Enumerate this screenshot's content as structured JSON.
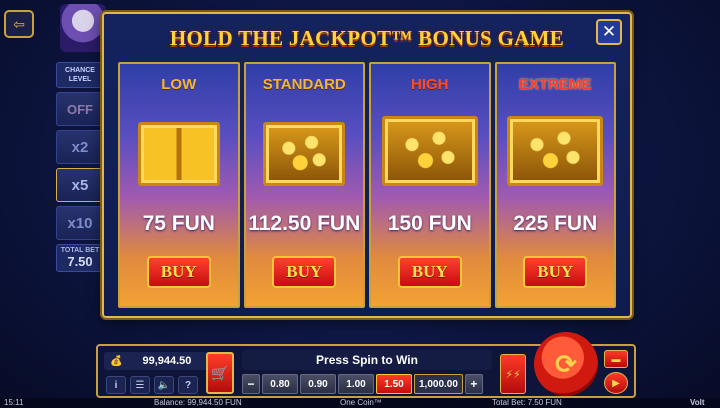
{
  "modal": {
    "title": "HOLD THE JACKPOT™ BONUS GAME",
    "close_glyph": "✕",
    "cards": [
      {
        "label": "LOW",
        "amount": "75 FUN",
        "buy": "BUY"
      },
      {
        "label": "STANDARD",
        "amount": "112.50 FUN",
        "buy": "BUY"
      },
      {
        "label": "HIGH",
        "amount": "150 FUN",
        "buy": "BUY"
      },
      {
        "label": "EXTREME",
        "amount": "225 FUN",
        "buy": "BUY"
      }
    ]
  },
  "side": {
    "chance_level_label": "CHANCE LEVEL",
    "options": [
      "OFF",
      "x2",
      "x5",
      "x10"
    ],
    "selected": "x5",
    "total_bet_label": "TOTAL BET",
    "total_bet_value": "7.50"
  },
  "bottom": {
    "balance_value": "99,944.50",
    "message": "Press Spin to Win",
    "bets": [
      "0.80",
      "0.90",
      "1.00",
      "1.50",
      "1,000.00"
    ],
    "selected_bet": "1.50",
    "minus": "−",
    "plus": "+",
    "info_glyph": "i",
    "menu_glyph": "☰",
    "sound_glyph": "🔈",
    "help_glyph": "?"
  },
  "status": {
    "time": "15:11",
    "balance": "Balance: 99,944.50 FUN",
    "game": "One Coin™",
    "total_bet": "Total Bet: 7.50 FUN",
    "brand": "Volt"
  },
  "colors": {
    "gold": "#e0b84c",
    "red": "#c40d0d",
    "title": "#ffd43a"
  }
}
